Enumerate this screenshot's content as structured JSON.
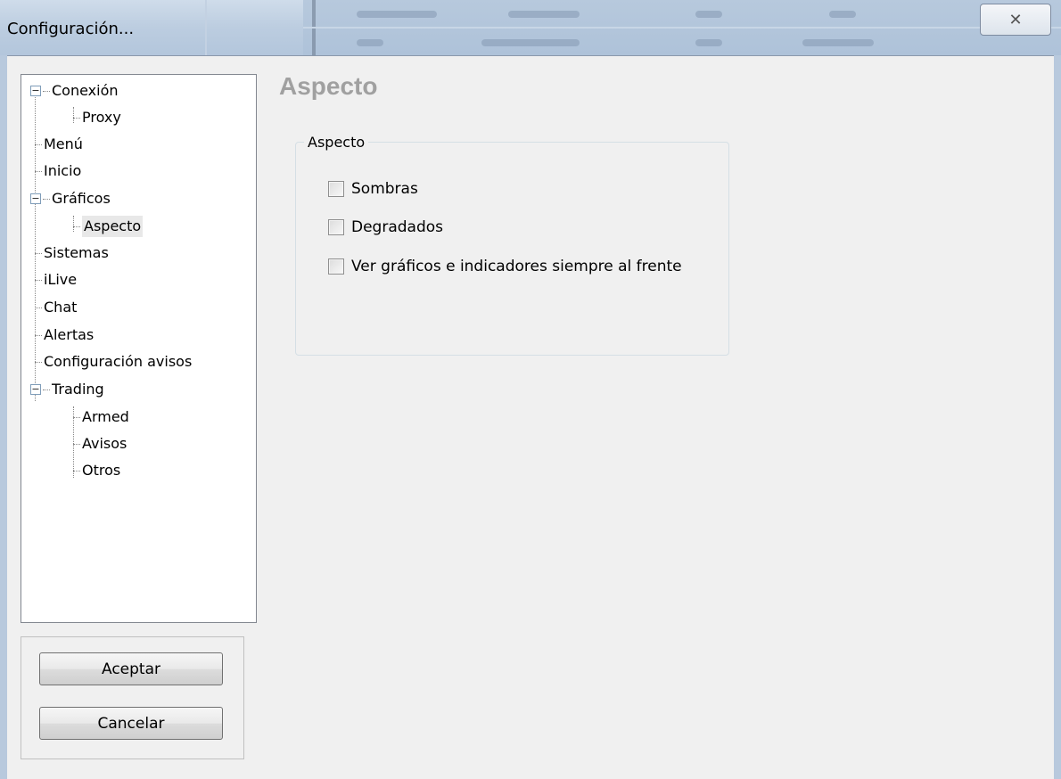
{
  "window": {
    "title": "Configuración...",
    "close_symbol": "✕"
  },
  "tree": {
    "items": [
      {
        "label": "Conexión",
        "level": 0,
        "expandable": true,
        "expanded": true
      },
      {
        "label": "Proxy",
        "level": 1
      },
      {
        "label": "Menú",
        "level": 0
      },
      {
        "label": "Inicio",
        "level": 0
      },
      {
        "label": "Gráficos",
        "level": 0,
        "expandable": true,
        "expanded": true
      },
      {
        "label": "Aspecto",
        "level": 1,
        "selected": true
      },
      {
        "label": "Sistemas",
        "level": 0
      },
      {
        "label": "iLive",
        "level": 0
      },
      {
        "label": "Chat",
        "level": 0
      },
      {
        "label": "Alertas",
        "level": 0
      },
      {
        "label": "Configuración avisos",
        "level": 0
      },
      {
        "label": "Trading",
        "level": 0,
        "expandable": true,
        "expanded": true
      },
      {
        "label": "Armed",
        "level": 1
      },
      {
        "label": "Avisos",
        "level": 1
      },
      {
        "label": "Otros",
        "level": 1
      }
    ]
  },
  "buttons": {
    "accept": "Aceptar",
    "cancel": "Cancelar"
  },
  "main": {
    "section_title": "Aspecto",
    "group_title": "Aspecto",
    "options": [
      {
        "label": "Sombras",
        "checked": false
      },
      {
        "label": "Degradados",
        "checked": false
      },
      {
        "label": "Ver gráficos e indicadores siempre al frente",
        "checked": false
      }
    ]
  },
  "colors": {
    "title_bar": "#bccde0",
    "section_title": "#a0a0a0",
    "selected_item_bg": "#e8e8e8"
  }
}
